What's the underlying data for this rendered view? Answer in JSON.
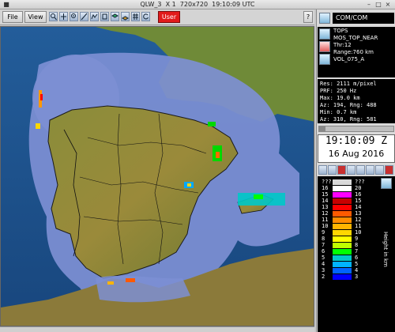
{
  "window": {
    "title": "QLW_3  X 1  720x720  19:10:09 UTC"
  },
  "toolbar": {
    "file_label": "File",
    "view_label": "View",
    "user_label": "User",
    "help_label": "?"
  },
  "panel": {
    "com_label": "COM/COM",
    "product": {
      "name": "TOPS",
      "mosaic": "MOS_TOP_NEAR",
      "thr": "Thr:12",
      "range": "Range:760 km",
      "vol": "VOL_075_A"
    },
    "stats": {
      "res": "Res: 2111 m/pixel",
      "prf": "PRF: 250 Hz",
      "max": "Max: 19.0 km",
      "az1": "Az: 194, Rng: 488",
      "min": "Min: 0.7 km",
      "az2": "Az: 310, Rng: 581"
    },
    "time": "19:10:09 Z",
    "date": "16 Aug 2016",
    "legend_axis": "Height in km",
    "legend": {
      "left": [
        "???",
        "16",
        "15",
        "14",
        "13",
        "12",
        "11",
        "10",
        "9",
        "8",
        "7",
        "6",
        "5",
        "4",
        "3",
        "2"
      ],
      "right": [
        "???",
        "20",
        "16",
        "15",
        "14",
        "13",
        "12",
        "11",
        "10",
        "9",
        "8",
        "7",
        "6",
        "5",
        "4",
        "3"
      ],
      "colors": [
        "#d9d9d9",
        "#ffffff",
        "#ff00ff",
        "#c80000",
        "#ff0000",
        "#ff5a00",
        "#ff8c00",
        "#ffb400",
        "#ffd700",
        "#ffff00",
        "#bfff00",
        "#00ff00",
        "#00c8c8",
        "#00b4ff",
        "#0064ff",
        "#0000ff"
      ]
    }
  }
}
